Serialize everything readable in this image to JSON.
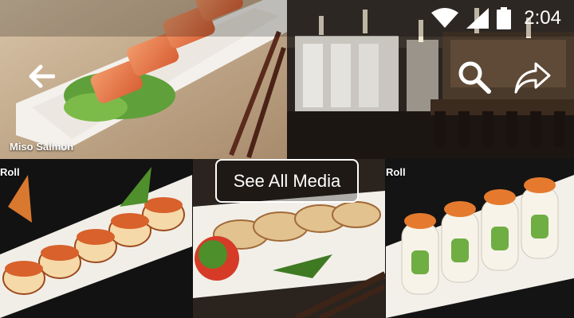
{
  "status_bar": {
    "time": "2:04",
    "icons": [
      "wifi-icon",
      "cellular-signal-icon",
      "battery-icon"
    ]
  },
  "toolbar": {
    "back_icon": "back-arrow-icon",
    "search_icon": "search-icon",
    "share_icon": "share-icon"
  },
  "gallery": {
    "tiles": [
      {
        "label": "Miso Salmon"
      },
      {
        "label": ""
      },
      {
        "label": "Roll"
      },
      {
        "label": ""
      },
      {
        "label": "Roll"
      }
    ],
    "see_all_label": "See All Media"
  },
  "colors": {
    "overlay_text": "#ffffff",
    "plate_white": "#f3f0ea",
    "restaurant_floor": "#1a1410",
    "salmon": "#e8784a"
  }
}
